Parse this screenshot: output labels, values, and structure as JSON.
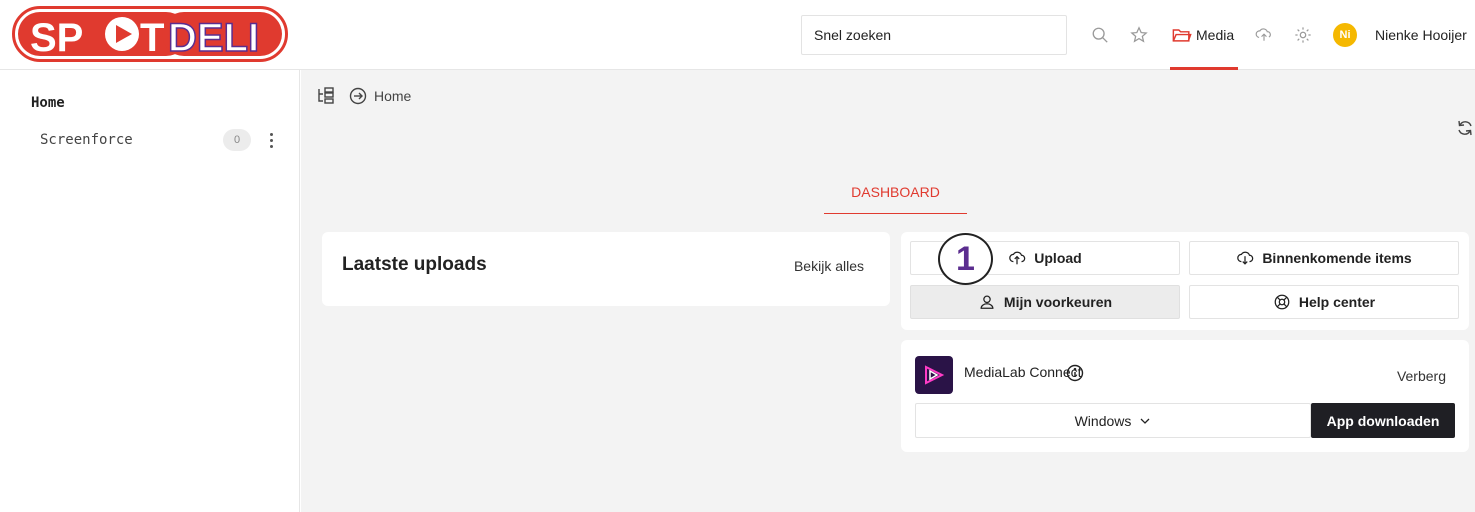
{
  "brand": {
    "logo_text": "SPOTDELI",
    "accent": "#e03a2f"
  },
  "header": {
    "search_placeholder": "Snel zoeken",
    "media_label": "Media",
    "avatar_initials": "Ni",
    "user_name": "Nienke Hooijer"
  },
  "sidebar": {
    "home_label": "Home",
    "items": [
      {
        "label": "Screenforce",
        "count": "0"
      }
    ]
  },
  "breadcrumb": {
    "home_label": "Home"
  },
  "tabs": {
    "dashboard_label": "DASHBOARD"
  },
  "uploads": {
    "title": "Laatste uploads",
    "view_all": "Bekijk alles"
  },
  "actions": {
    "upload": "Upload",
    "incoming": "Binnenkomende items",
    "preferences": "Mijn voorkeuren",
    "help": "Help center"
  },
  "annotation": {
    "step": "1"
  },
  "connect": {
    "title": "MediaLab Connect",
    "hide": "Verberg",
    "os_selected": "Windows",
    "download": "App downloaden"
  }
}
